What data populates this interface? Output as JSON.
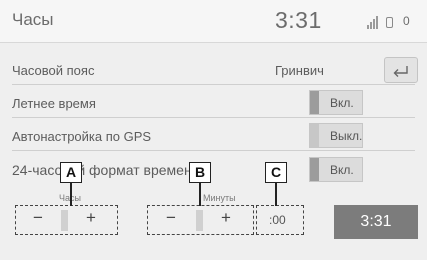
{
  "header": {
    "title": "Часы",
    "time": "3:31",
    "status_digit": "0"
  },
  "rows": {
    "timezone": {
      "label": "Часовой пояс",
      "value": "Гринвич"
    },
    "dst": {
      "label": "Летнее время",
      "toggle": "Вкл.",
      "enabled": true
    },
    "gps": {
      "label": "Автонастройка по GPS",
      "toggle": "Выкл.",
      "enabled": false
    },
    "format24": {
      "label": "24-часовой формат времени",
      "toggle": "Вкл.",
      "enabled": true
    }
  },
  "hours": {
    "caption": "Часы",
    "minus": "−",
    "plus": "+"
  },
  "minutes": {
    "caption": "Минуты",
    "minus": "−",
    "plus": "+"
  },
  "reset": {
    "value": ":00"
  },
  "clock_button": {
    "label": "3:31"
  },
  "callouts": {
    "a": "A",
    "b": "B",
    "c": "C"
  },
  "colors": {
    "indicator_on": "#9c9c9c",
    "indicator_off": "#c7c7c7",
    "clock_button": "#7c7c7c"
  },
  "icons": {
    "back": "back-arrow-icon",
    "signal": "signal-icon",
    "battery": "battery-icon"
  }
}
